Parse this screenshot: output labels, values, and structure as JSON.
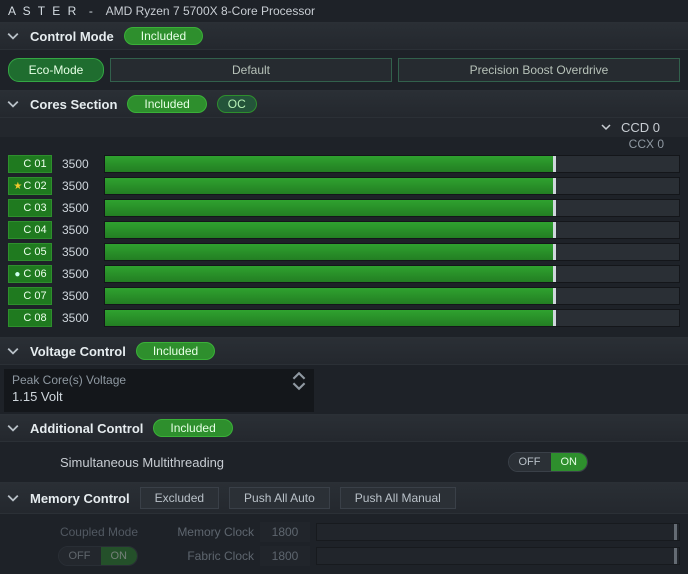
{
  "header": {
    "app_fragment": "A S T E R",
    "sep": "-",
    "cpu": "AMD Ryzen 7 5700X 8-Core Processor"
  },
  "control_mode": {
    "title": "Control Mode",
    "badge": "Included",
    "eco": "Eco-Mode",
    "default": "Default",
    "pbo": "Precision Boost Overdrive"
  },
  "cores_section": {
    "title": "Cores Section",
    "badge": "Included",
    "oc": "OC",
    "ccd": "CCD 0",
    "ccx": "CCX 0",
    "cores": [
      {
        "id": "C 01",
        "freq": "3500",
        "mark": ""
      },
      {
        "id": "C 02",
        "freq": "3500",
        "mark": "★"
      },
      {
        "id": "C 03",
        "freq": "3500",
        "mark": ""
      },
      {
        "id": "C 04",
        "freq": "3500",
        "mark": ""
      },
      {
        "id": "C 05",
        "freq": "3500",
        "mark": ""
      },
      {
        "id": "C 06",
        "freq": "3500",
        "mark": "●"
      },
      {
        "id": "C 07",
        "freq": "3500",
        "mark": ""
      },
      {
        "id": "C 08",
        "freq": "3500",
        "mark": ""
      }
    ]
  },
  "voltage": {
    "title": "Voltage Control",
    "badge": "Included",
    "label": "Peak Core(s) Voltage",
    "value": "1.15 Volt"
  },
  "additional": {
    "title": "Additional Control",
    "badge": "Included",
    "smt_label": "Simultaneous Multithreading",
    "off": "OFF",
    "on": "ON"
  },
  "memory": {
    "title": "Memory Control",
    "badge": "Excluded",
    "push_auto": "Push All Auto",
    "push_manual": "Push All Manual",
    "coupled": "Coupled Mode",
    "off": "OFF",
    "on": "ON",
    "mem_clock_label": "Memory Clock",
    "mem_clock_val": "1800",
    "fab_clock_label": "Fabric Clock",
    "fab_clock_val": "1800"
  }
}
